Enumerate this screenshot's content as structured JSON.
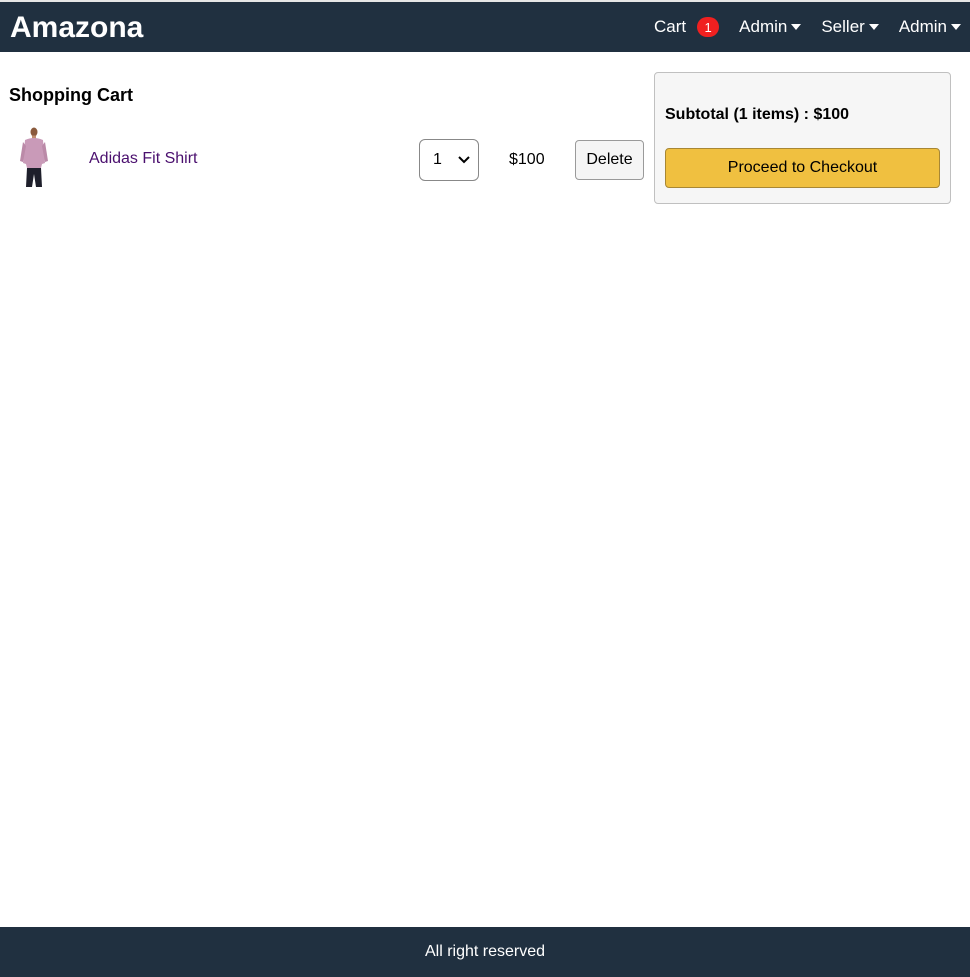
{
  "header": {
    "brand": "Amazona",
    "cart_label": "Cart",
    "cart_count": "1",
    "menus": [
      {
        "label": "Admin"
      },
      {
        "label": "Seller"
      },
      {
        "label": "Admin"
      }
    ]
  },
  "cart": {
    "title": "Shopping Cart",
    "items": [
      {
        "name": "Adidas Fit Shirt",
        "quantity": "1",
        "price": "$100",
        "delete_label": "Delete",
        "image_icon": "shirt-product-image"
      }
    ]
  },
  "summary": {
    "subtotal": "Subtotal (1 items) : $100",
    "checkout_label": "Proceed to Checkout"
  },
  "footer": {
    "text": "All right reserved"
  },
  "colors": {
    "navbar": "#203040",
    "badge": "#f02020",
    "checkout_button": "#f0c040",
    "product_link": "#4a0f6e"
  }
}
